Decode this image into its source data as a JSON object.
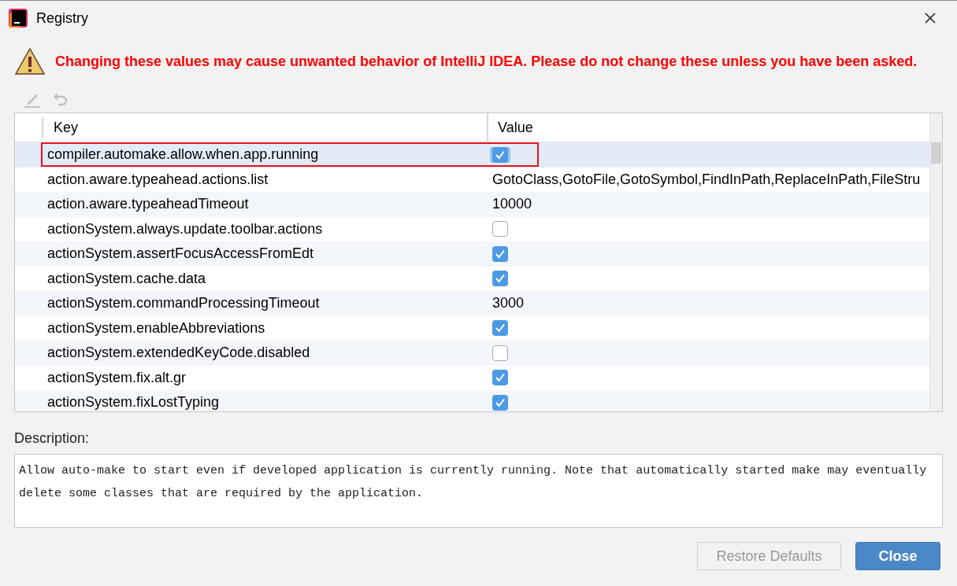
{
  "window": {
    "title": "Registry"
  },
  "warning": "Changing these values may cause unwanted behavior of IntelliJ IDEA. Please do not change these unless you have been asked.",
  "table": {
    "columns": [
      "Key",
      "Value"
    ],
    "rows": [
      {
        "key": "compiler.automake.allow.when.app.running",
        "kind": "checkbox",
        "checked": true,
        "selected": true,
        "annotated": true
      },
      {
        "key": "action.aware.typeahead.actions.list",
        "kind": "text",
        "value": "GotoClass,GotoFile,GotoSymbol,FindInPath,ReplaceInPath,FileStru",
        "selected": false,
        "annotated": false
      },
      {
        "key": "action.aware.typeaheadTimeout",
        "kind": "text",
        "value": "10000",
        "selected": false,
        "annotated": false
      },
      {
        "key": "actionSystem.always.update.toolbar.actions",
        "kind": "checkbox",
        "checked": false,
        "selected": false,
        "annotated": false
      },
      {
        "key": "actionSystem.assertFocusAccessFromEdt",
        "kind": "checkbox",
        "checked": true,
        "selected": false,
        "annotated": false
      },
      {
        "key": "actionSystem.cache.data",
        "kind": "checkbox",
        "checked": true,
        "selected": false,
        "annotated": false
      },
      {
        "key": "actionSystem.commandProcessingTimeout",
        "kind": "text",
        "value": "3000",
        "selected": false,
        "annotated": false
      },
      {
        "key": "actionSystem.enableAbbreviations",
        "kind": "checkbox",
        "checked": true,
        "selected": false,
        "annotated": false
      },
      {
        "key": "actionSystem.extendedKeyCode.disabled",
        "kind": "checkbox",
        "checked": false,
        "selected": false,
        "annotated": false
      },
      {
        "key": "actionSystem.fix.alt.gr",
        "kind": "checkbox",
        "checked": true,
        "selected": false,
        "annotated": false
      },
      {
        "key": "actionSystem.fixLostTyping",
        "kind": "checkbox",
        "checked": true,
        "selected": false,
        "annotated": false
      }
    ]
  },
  "description": {
    "label": "Description:",
    "text": "Allow auto-make to start even if developed application is currently running. Note that automatically started make may eventually delete some classes that are required by the application."
  },
  "buttons": [
    {
      "label": "Restore Defaults",
      "disabled": true,
      "primary": false
    },
    {
      "label": "Close",
      "disabled": false,
      "primary": true
    }
  ]
}
